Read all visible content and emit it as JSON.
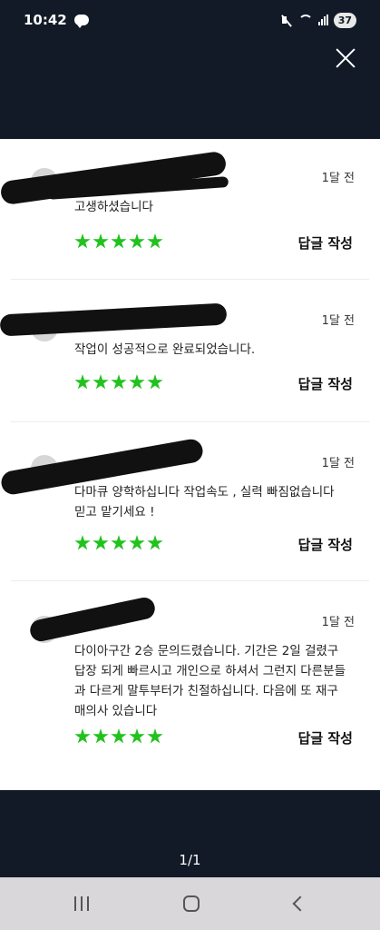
{
  "status_bar": {
    "time": "10:42",
    "battery": "37",
    "icons": [
      "kakaotalk-icon",
      "mute-icon",
      "wifi-icon",
      "signal-icon"
    ]
  },
  "reviews": [
    {
      "date": "1달 전",
      "text": "고생하셨습니다",
      "rating": 5,
      "reply_label": "답글 작성"
    },
    {
      "date": "1달 전",
      "text": "작업이 성공적으로 완료되었습니다.",
      "rating": 5,
      "reply_label": "답글 작성"
    },
    {
      "date": "1달 전",
      "text": "다마큐 양학하십니다 작업속도 , 실력 빠짐없습니다 믿고 맡기세요 !",
      "rating": 5,
      "reply_label": "답글 작성"
    },
    {
      "date": "1달 전",
      "text": "다이아구간 2승 문의드렸습니다. 기간은 2일 걸렸구 답장 되게 빠르시고 개인으로 하셔서 그런지 다른분들과 다르게 말투부터가 친절하십니다. 다음에 또 재구매의사 있습니다",
      "rating": 5,
      "reply_label": "답글 작성"
    }
  ],
  "pagination": {
    "label": "1/1"
  },
  "colors": {
    "star": "#22c21e",
    "dark_bg": "#121a27",
    "nav_bg": "#d9d7d9"
  }
}
